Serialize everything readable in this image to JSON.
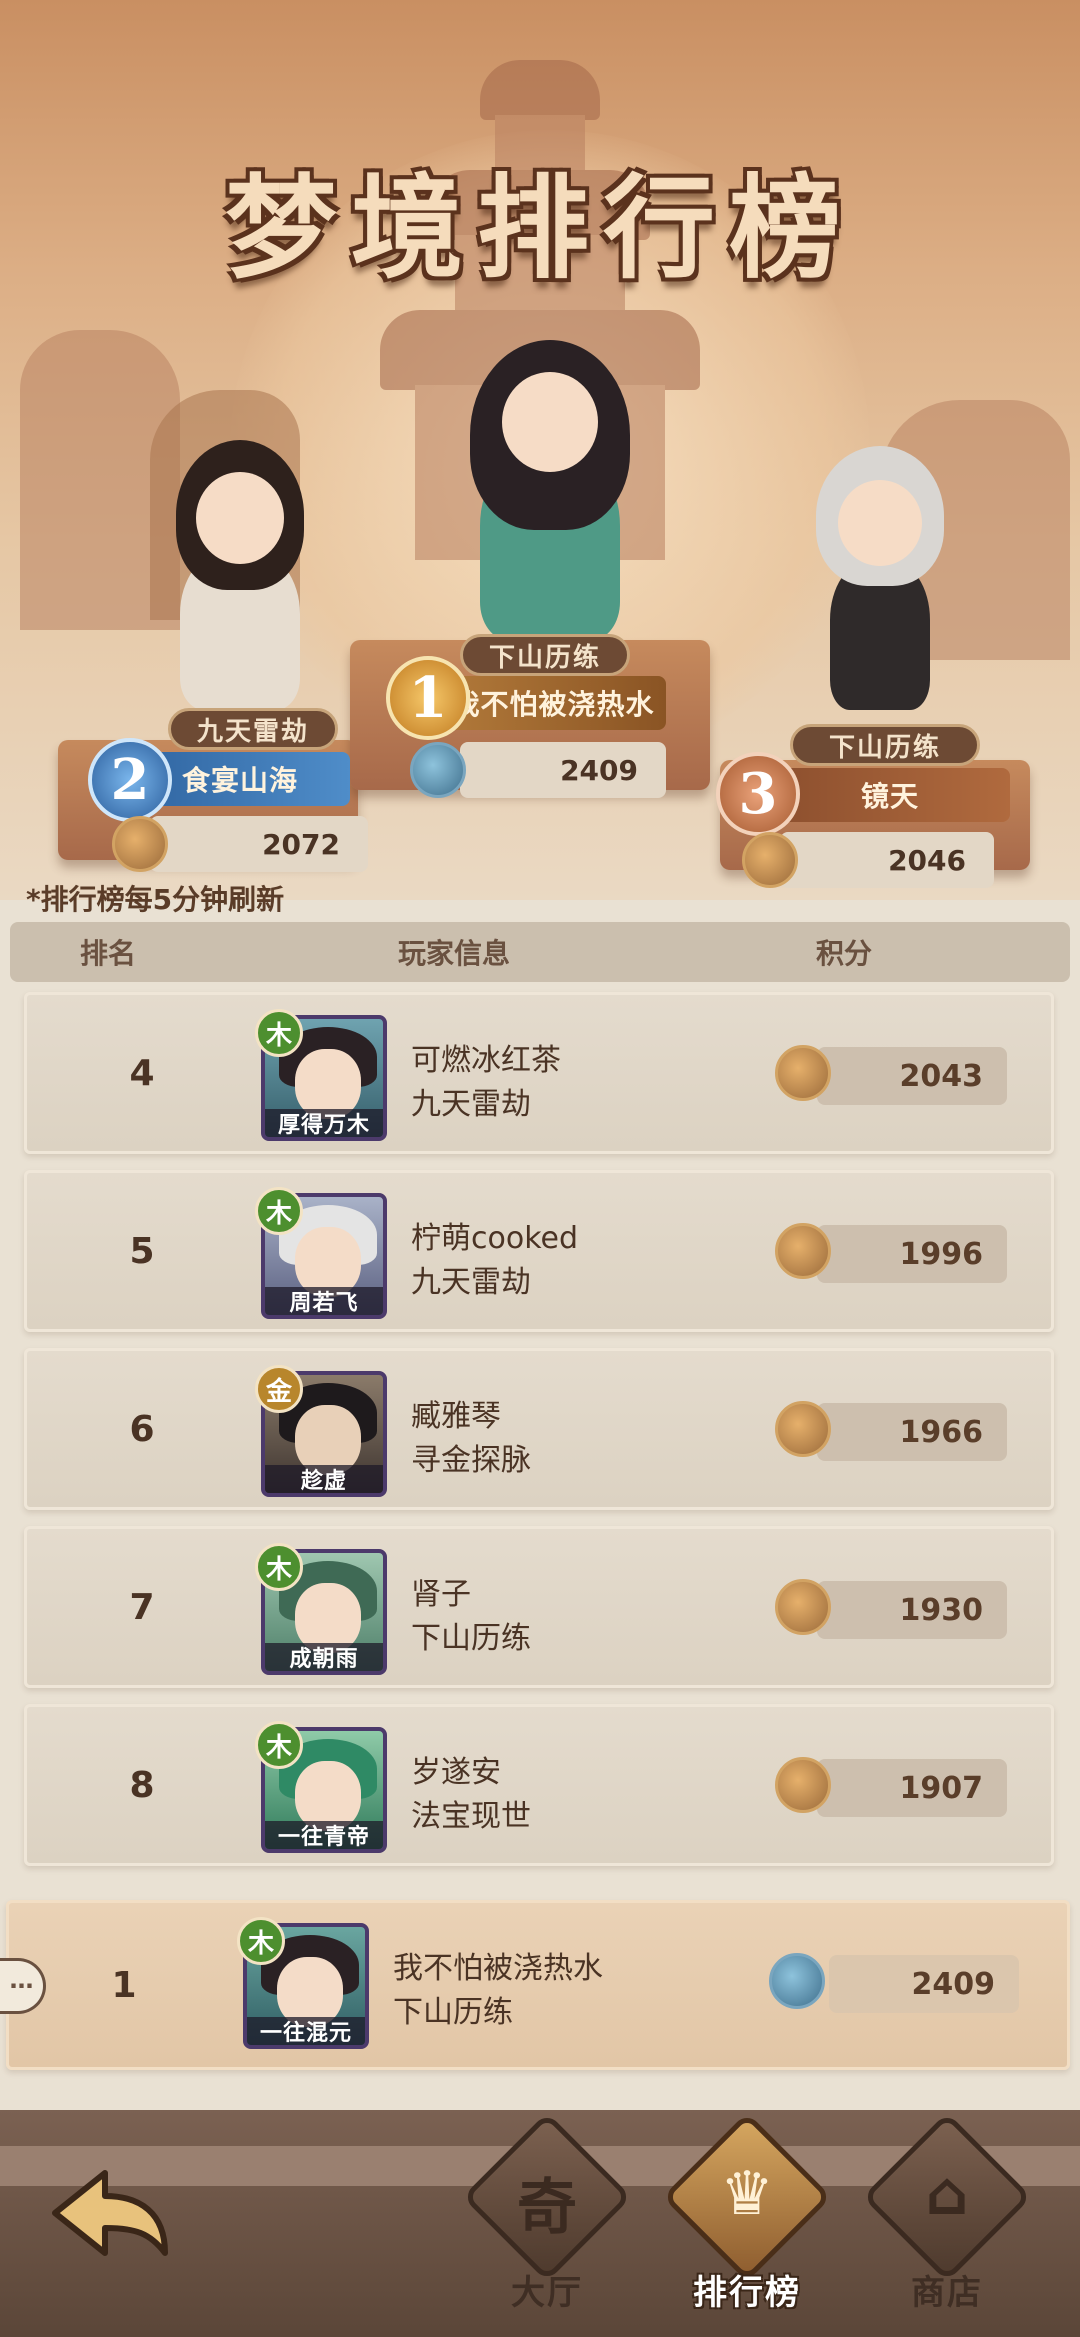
{
  "header": {
    "title": "梦境排行榜",
    "refresh_note": "*排行榜每5分钟刷新"
  },
  "podium": [
    {
      "rank": "1",
      "tag": "下山历练",
      "name": "我不怕被浇热水",
      "score": "2409",
      "badge": "blue-spirit-badge"
    },
    {
      "rank": "2",
      "tag": "九天雷劫",
      "name": "食宴山海",
      "score": "2072",
      "badge": "bronze-mask-badge"
    },
    {
      "rank": "3",
      "tag": "下山历练",
      "name": "镜天",
      "score": "2046",
      "badge": "bronze-mask-badge"
    }
  ],
  "table": {
    "headers": {
      "rank": "排名",
      "player": "玩家信息",
      "score": "积分"
    },
    "rows": [
      {
        "rank": "4",
        "element": "木",
        "hero": "厚得万木",
        "name": "可燃冰红茶",
        "guild": "九天雷劫",
        "score": "2043"
      },
      {
        "rank": "5",
        "element": "木",
        "hero": "周若飞",
        "name": "柠萌cooked",
        "guild": "九天雷劫",
        "score": "1996"
      },
      {
        "rank": "6",
        "element": "金",
        "hero": "趁虚",
        "name": "臧雅琴",
        "guild": "寻金探脉",
        "score": "1966"
      },
      {
        "rank": "7",
        "element": "木",
        "hero": "成朝雨",
        "name": "肾子",
        "guild": "下山历练",
        "score": "1930"
      },
      {
        "rank": "8",
        "element": "木",
        "hero": "一往青帝",
        "name": "岁遂安",
        "guild": "法宝现世",
        "score": "1907"
      }
    ],
    "mine": {
      "rank": "1",
      "element": "木",
      "hero": "一往混元",
      "name": "我不怕被浇热水",
      "guild": "下山历练",
      "score": "2409"
    }
  },
  "nav": {
    "items": [
      {
        "label": "大厅",
        "icon": "hall-icon",
        "glyph": "奇"
      },
      {
        "label": "排行榜",
        "icon": "ranking-icon",
        "glyph": "♛"
      },
      {
        "label": "商店",
        "icon": "shop-icon",
        "glyph": "⌂"
      }
    ],
    "active": "排行榜"
  },
  "colors": {
    "accent_gold": "#d6a760",
    "rank2_blue": "#3e7ab7",
    "rank3_bronze": "#c87a4a",
    "text_dark": "#4a3324"
  }
}
